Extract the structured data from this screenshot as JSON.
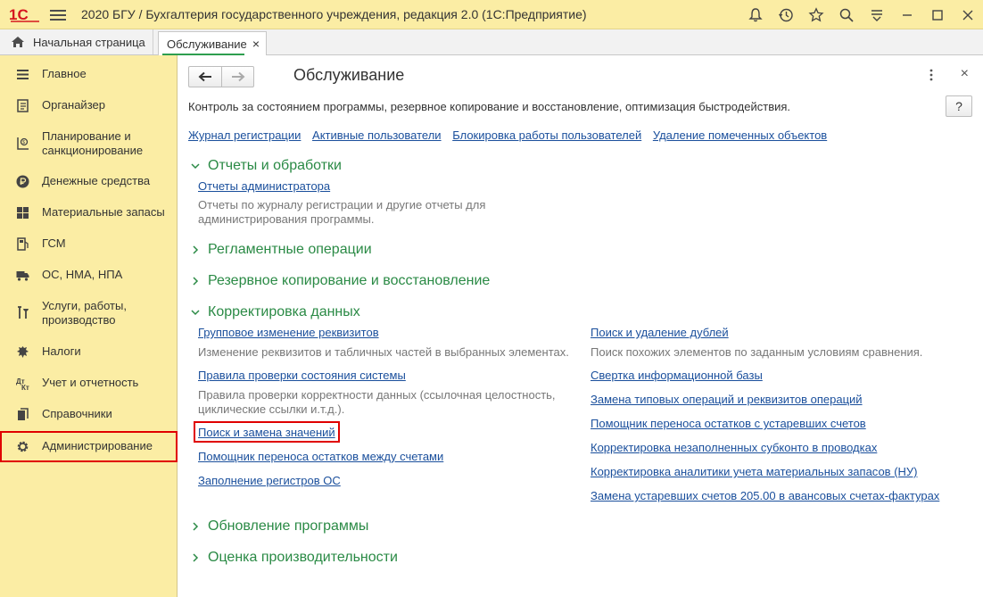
{
  "window": {
    "title": "2020 БГУ / Бухгалтерия государственного учреждения, редакция 2.0  (1С:Предприятие)",
    "icons": [
      "bell-icon",
      "history-icon",
      "star-icon",
      "search-icon",
      "menu-down-icon",
      "minimize-icon",
      "maximize-icon",
      "close-icon"
    ]
  },
  "tabs": {
    "home_label": "Начальная страница",
    "active_label": "Обслуживание",
    "close_glyph": "×"
  },
  "sidebar": {
    "items": [
      {
        "label": "Главное",
        "icon": "menu-icon"
      },
      {
        "label": "Органайзер",
        "icon": "notebook-icon"
      },
      {
        "label": "Планирование и санкционирование",
        "icon": "planning-icon"
      },
      {
        "label": "Денежные средства",
        "icon": "ruble-icon"
      },
      {
        "label": "Материальные запасы",
        "icon": "grid-icon"
      },
      {
        "label": "ГСМ",
        "icon": "fuel-icon"
      },
      {
        "label": "ОС, НМА, НПА",
        "icon": "truck-icon"
      },
      {
        "label": "Услуги, работы, производство",
        "icon": "tools-icon"
      },
      {
        "label": "Налоги",
        "icon": "emblem-icon"
      },
      {
        "label": "Учет и отчетность",
        "icon": "accounting-icon"
      },
      {
        "label": "Справочники",
        "icon": "books-icon"
      },
      {
        "label": "Администрирование",
        "icon": "gear-icon"
      }
    ]
  },
  "main": {
    "title": "Обслуживание",
    "help_label": "?",
    "description": "Контроль за состоянием программы, резервное копирование и восстановление, оптимизация быстродействия.",
    "top_links": [
      "Журнал регистрации",
      "Активные пользователи",
      "Блокировка работы пользователей",
      "Удаление помеченных объектов"
    ],
    "groups": {
      "reports": {
        "title": "Отчеты и обработки",
        "link": "Отчеты администратора",
        "note": "Отчеты по журналу регистрации и другие отчеты для администрирования программы."
      },
      "routine": {
        "title": "Регламентные операции"
      },
      "backup": {
        "title": "Резервное копирование и восстановление"
      },
      "correction": {
        "title": "Корректировка данных",
        "left": {
          "group_change": "Групповое изменение реквизитов",
          "group_change_note": "Изменение реквизитов и табличных частей в выбранных элементах.",
          "check_rules": "Правила проверки состояния системы",
          "check_rules_note": "Правила проверки корректности данных (ссылочная целостность, циклические ссылки и.т.д.).",
          "search_replace": "Поиск и замена значений",
          "transfer_accounts": "Помощник переноса остатков между счетами",
          "os_registers": "Заполнение регистров ОС"
        },
        "right": {
          "duplicates": "Поиск и удаление дублей",
          "duplicates_note": "Поиск похожих элементов по заданным условиям сравнения.",
          "collapse_db": "Свертка информационной базы",
          "replace_ops": "Замена типовых операций и реквизитов операций",
          "transfer_obsolete": "Помощник переноса остатков с устаревших счетов",
          "subconto": "Корректировка незаполненных субконто в проводках",
          "analytics": "Корректировка аналитики учета материальных запасов (НУ)",
          "replace_205": "Замена устаревших счетов 205.00 в авансовых счетах-фактурах"
        }
      },
      "update": {
        "title": "Обновление программы"
      },
      "performance": {
        "title": "Оценка производительности"
      }
    }
  },
  "colors": {
    "sidebar_bg": "#fbeda4",
    "link": "#1a4f9c",
    "group_title": "#2a8a45",
    "highlight": "#e00000"
  }
}
